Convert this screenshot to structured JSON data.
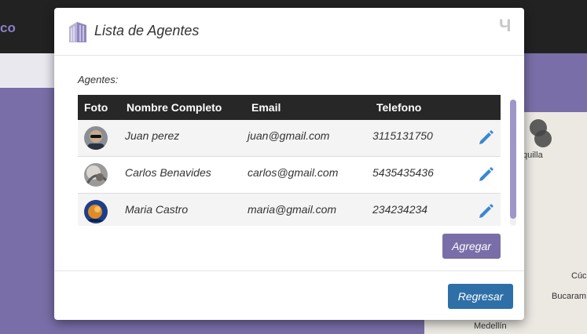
{
  "background": {
    "brand_fragment": "co",
    "map_labels": [
      "quilla",
      "Cúc",
      "Bucaram",
      "Medellín"
    ]
  },
  "modal": {
    "title": "Lista de Agentes",
    "close_glyph": "Ч",
    "section_label": "Agentes:",
    "table": {
      "headers": {
        "photo": "Foto",
        "name": "Nombre Completo",
        "email": "Email",
        "phone": "Telefono"
      },
      "rows": [
        {
          "name": "Juan perez",
          "email": "juan@gmail.com",
          "phone": "3115131750",
          "avatar_icon": "user-photo-sunglasses"
        },
        {
          "name": "Carlos Benavides",
          "email": "carlos@gmail.com",
          "phone": "5435435436",
          "avatar_icon": "user-photo-gray"
        },
        {
          "name": "Maria Castro",
          "email": "maria@gmail.com",
          "phone": "234234234",
          "avatar_icon": "user-photo-blue-orange"
        }
      ]
    },
    "add_button": "Agregar",
    "back_button": "Regresar"
  },
  "colors": {
    "accent_purple": "#7a6ea8",
    "primary_blue": "#2f6fa8",
    "header_dark": "#272727",
    "edit_icon_blue": "#3a87d0"
  }
}
